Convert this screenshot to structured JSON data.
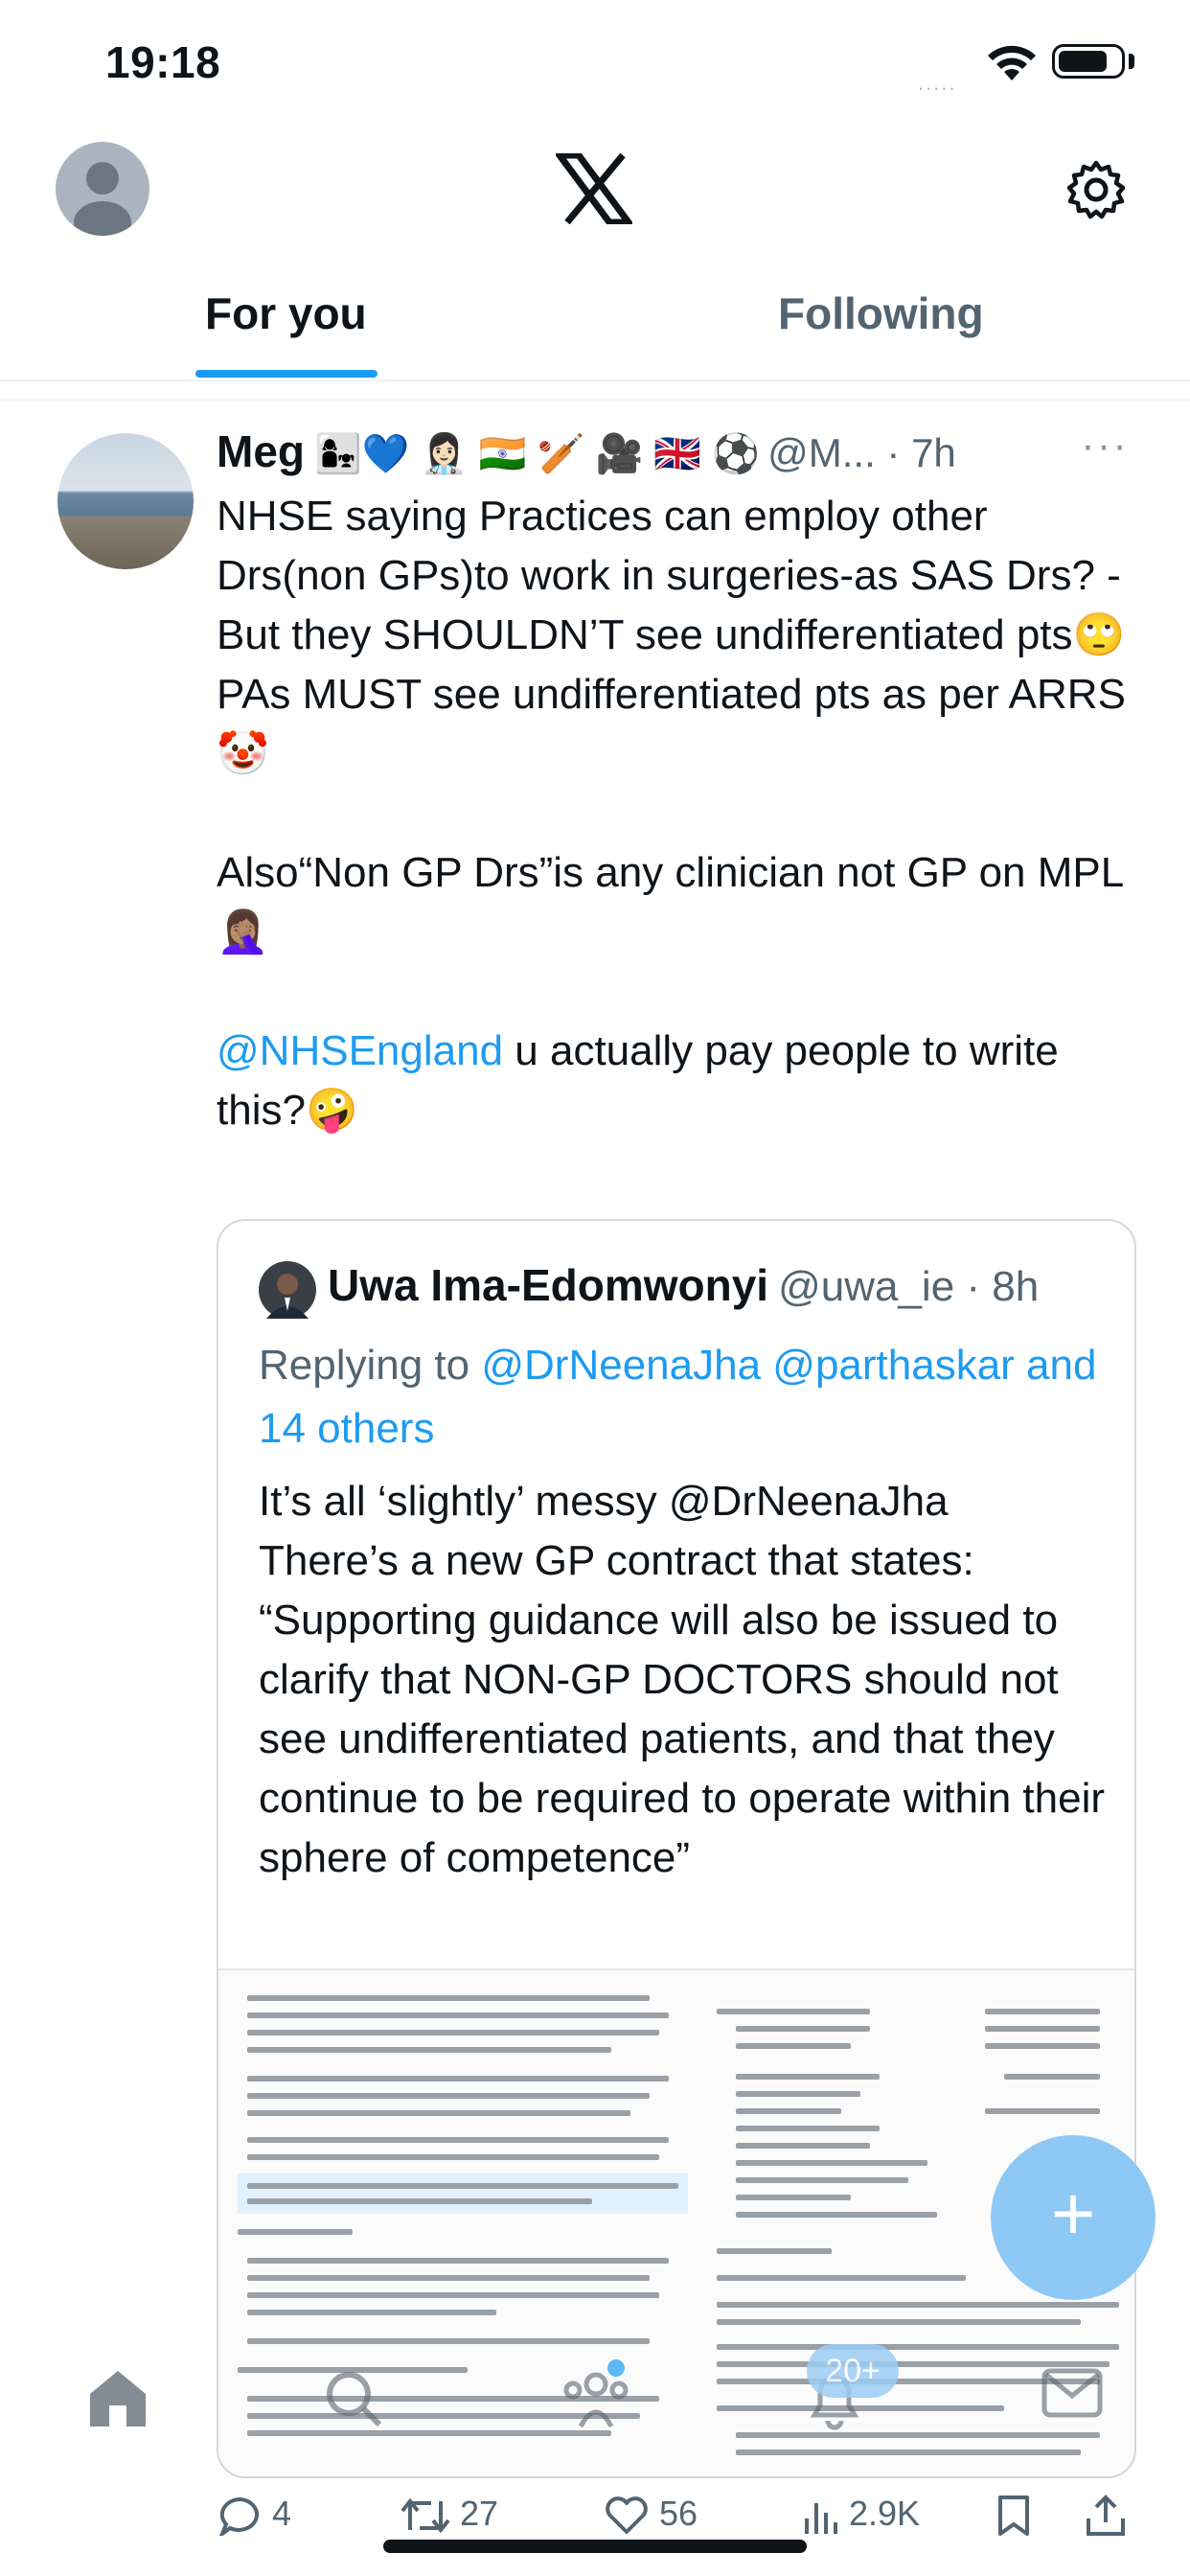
{
  "status_bar": {
    "time": "19:18",
    "signal": "....."
  },
  "header": {
    "logo": "x-logo",
    "settings_icon": "gear-icon",
    "avatar_icon": "default-avatar-icon"
  },
  "tabs": [
    {
      "label": "For you",
      "active": true
    },
    {
      "label": "Following",
      "active": false
    }
  ],
  "accent_color": "#1d9bf0",
  "tweet": {
    "author": "Meg",
    "author_emojis": "👩‍👧💙 👩🏻‍⚕️ 🇮🇳 🏏 🎥 🇬🇧 ⚽",
    "handle_time": "@M... · 7h",
    "more": "···",
    "text_part1": "NHSE saying Practices can employ other Drs(non GPs)to work in surgeries-as SAS Drs? -But they SHOULDN’T see undifferentiated pts🙄\nPAs MUST see undifferentiated pts as per ARRS🤡\n\nAlso“Non GP Drs”is any clinician not GP on MPL🤦🏽‍♀️\n\n",
    "mention": "@NHSEngland",
    "text_part2": " u actually pay people to write this?🤪"
  },
  "quote": {
    "name": "Uwa Ima-Edomwonyi",
    "handle_time": "@uwa_ie · 8h",
    "reply_prefix": "Replying to ",
    "reply_mentions": "@DrNeenaJha @parthaskar and 14 others",
    "text": "It’s all ‘slightly’ messy @DrNeenaJha\nThere’s a new GP contract that states:\n“Supporting guidance will also be issued to clarify that NON-GP DOCTORS should not see undifferentiated patients, and that they continue to be required to operate within their sphere of competence”"
  },
  "fab": {
    "icon": "plus-icon",
    "label": "+"
  },
  "bottom_nav": {
    "icons": [
      "home-icon",
      "search-icon",
      "communities-icon",
      "notifications-icon",
      "messages-icon"
    ],
    "badge": "20+"
  },
  "actions": {
    "replies": "4",
    "reposts": "27",
    "likes": "56",
    "views": "2.9K"
  }
}
